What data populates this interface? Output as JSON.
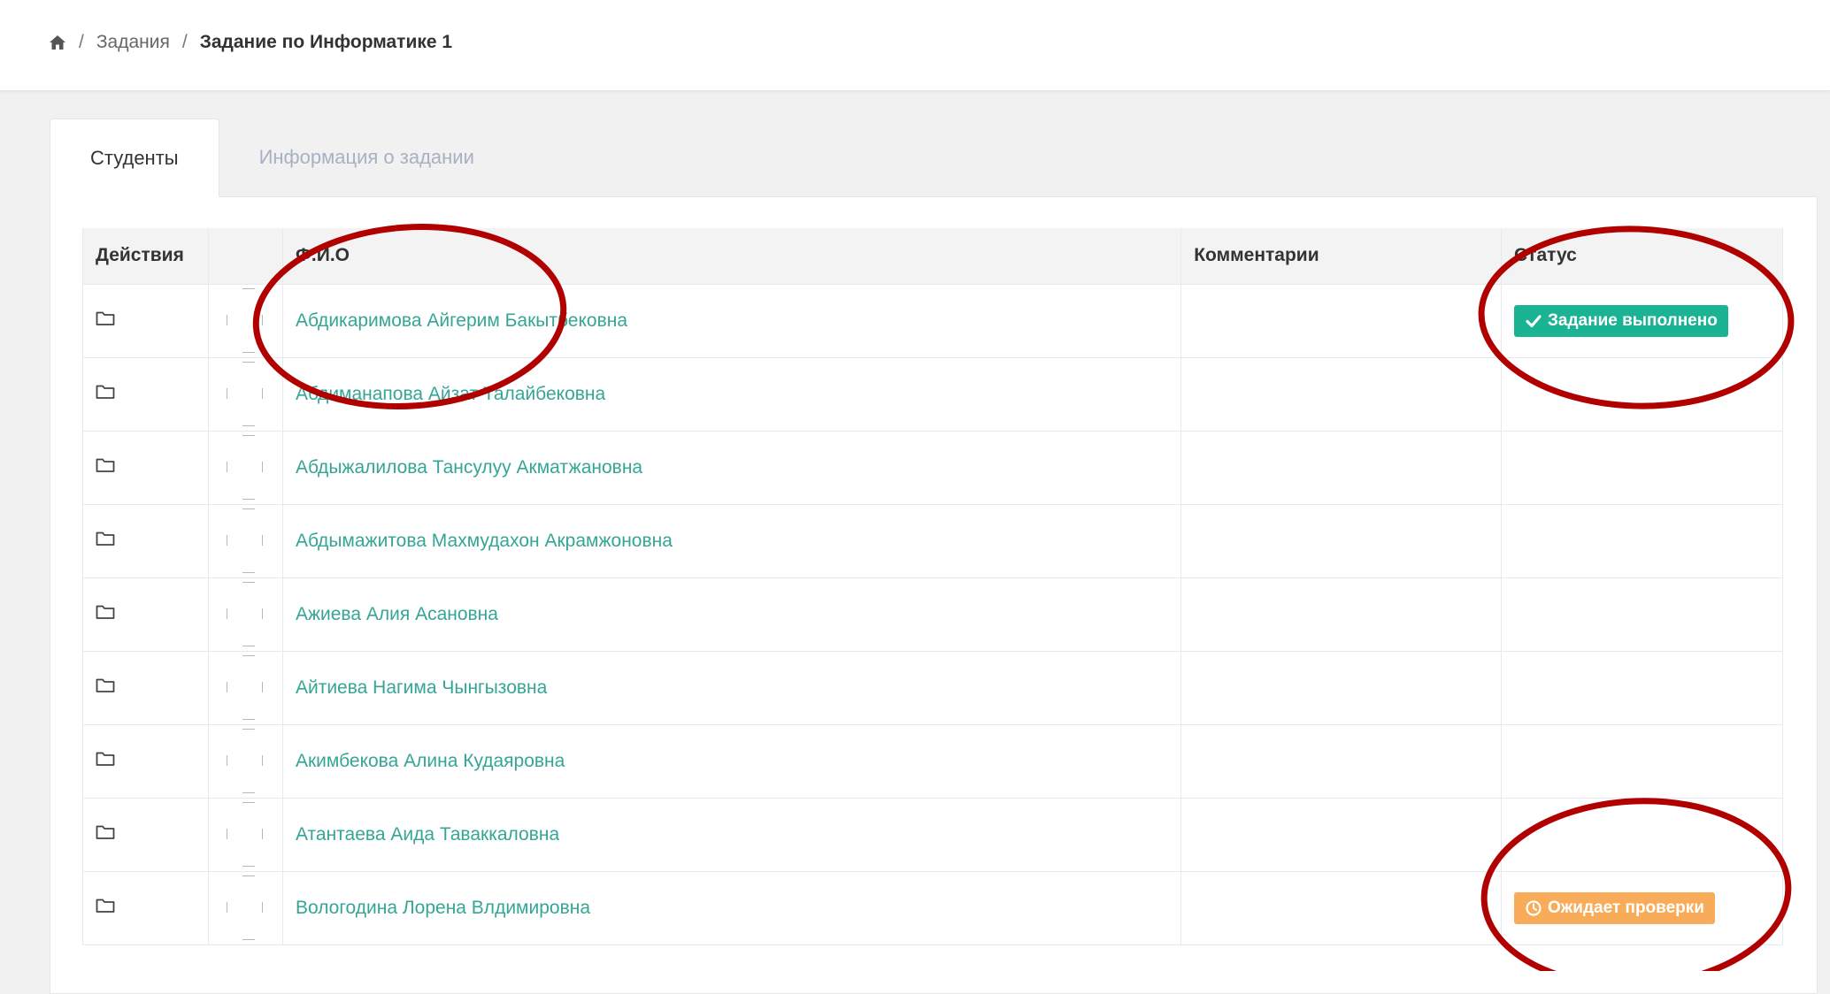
{
  "breadcrumb": {
    "home_icon": "home-icon",
    "items": [
      {
        "label": "Задания"
      },
      {
        "label": "Задание по Информатике 1"
      }
    ],
    "separator": "/"
  },
  "tabs": [
    {
      "label": "Студенты",
      "active": true
    },
    {
      "label": "Информация о задании",
      "active": false
    }
  ],
  "table": {
    "headers": {
      "actions": "Действия",
      "avatar": "",
      "name": "Ф.И.О",
      "comments": "Комментарии",
      "status": "Статус"
    },
    "rows": [
      {
        "name": "Абдикаримова Айгерим Бакытбековна",
        "comment": "",
        "status": "Задание выполнено",
        "status_type": "done"
      },
      {
        "name": "Абдиманапова Айзат Талайбековна",
        "comment": "",
        "status": "",
        "status_type": ""
      },
      {
        "name": "Абдыжалилова Тансулуу Акматжановна",
        "comment": "",
        "status": "",
        "status_type": ""
      },
      {
        "name": "Абдымажитова Махмудахон Акрамжоновна",
        "comment": "",
        "status": "",
        "status_type": ""
      },
      {
        "name": "Ажиева Алия Асановна",
        "comment": "",
        "status": "",
        "status_type": ""
      },
      {
        "name": "Айтиева Нагима Чынгызовна",
        "comment": "",
        "status": "",
        "status_type": ""
      },
      {
        "name": "Акимбекова Алина Кудаяровна",
        "comment": "",
        "status": "",
        "status_type": ""
      },
      {
        "name": "Атантаева Аида Таваккаловна",
        "comment": "",
        "status": "",
        "status_type": ""
      },
      {
        "name": "Вологодина Лорена Влдимировна",
        "comment": "",
        "status": "Ожидает проверки",
        "status_type": "pending"
      }
    ]
  },
  "colors": {
    "link": "#35a596",
    "badge_done": "#1ab394",
    "badge_pending": "#f8ac59",
    "annotation": "#b00000"
  }
}
